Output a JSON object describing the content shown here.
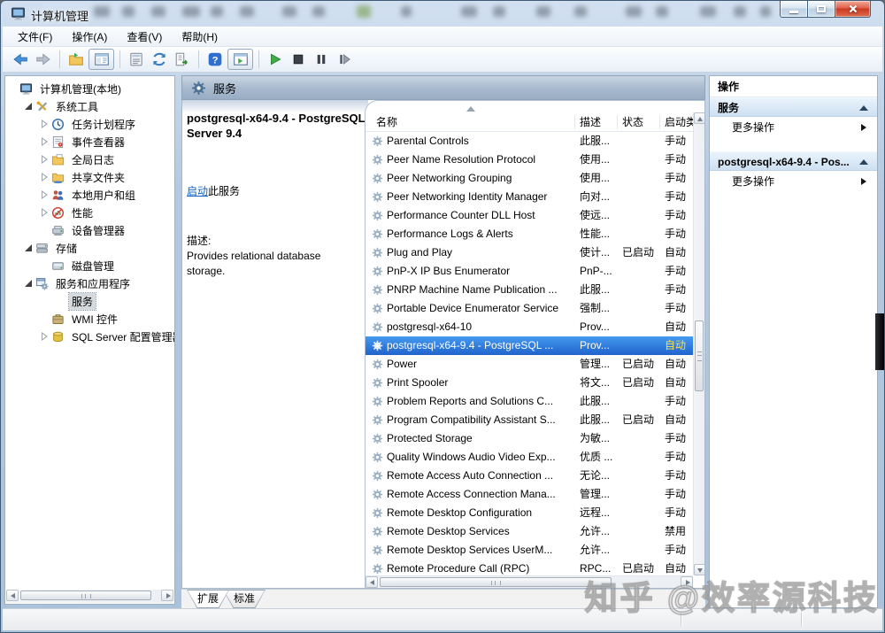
{
  "window": {
    "title": "计算机管理"
  },
  "menu": {
    "items": [
      "文件(F)",
      "操作(A)",
      "查看(V)",
      "帮助(H)"
    ]
  },
  "toolbar": {
    "buttons": [
      {
        "icon": "back"
      },
      {
        "icon": "forward"
      },
      {
        "sep": true
      },
      {
        "icon": "export-folder"
      },
      {
        "icon": "console-window",
        "framed": true
      },
      {
        "sep": true
      },
      {
        "icon": "properties"
      },
      {
        "icon": "refresh"
      },
      {
        "icon": "export-list"
      },
      {
        "sep": true
      },
      {
        "icon": "help"
      },
      {
        "icon": "console-play",
        "framed": true
      },
      {
        "sep": true
      },
      {
        "icon": "start-service"
      },
      {
        "icon": "stop-service"
      },
      {
        "icon": "pause-service"
      },
      {
        "icon": "restart-service"
      }
    ]
  },
  "tree": {
    "items": [
      {
        "label": "计算机管理(本地)",
        "icon": "computer",
        "depth": 0,
        "arrow": null,
        "selected": false
      },
      {
        "label": "系统工具",
        "icon": "tools",
        "depth": 1,
        "arrow": "expanded",
        "selected": false
      },
      {
        "label": "任务计划程序",
        "icon": "scheduler",
        "depth": 2,
        "arrow": "collapsed",
        "selected": false
      },
      {
        "label": "事件查看器",
        "icon": "event-viewer",
        "depth": 2,
        "arrow": "collapsed",
        "selected": false
      },
      {
        "label": "全局日志",
        "icon": "logs",
        "depth": 2,
        "arrow": "collapsed",
        "selected": false
      },
      {
        "label": "共享文件夹",
        "icon": "shared-folders",
        "depth": 2,
        "arrow": "collapsed",
        "selected": false
      },
      {
        "label": "本地用户和组",
        "icon": "local-users",
        "depth": 2,
        "arrow": "collapsed",
        "selected": false
      },
      {
        "label": "性能",
        "icon": "performance",
        "depth": 2,
        "arrow": "collapsed",
        "selected": false
      },
      {
        "label": "设备管理器",
        "icon": "device-manager",
        "depth": 2,
        "arrow": null,
        "selected": false
      },
      {
        "label": "存储",
        "icon": "storage",
        "depth": 1,
        "arrow": "expanded",
        "selected": false
      },
      {
        "label": "磁盘管理",
        "icon": "disk-management",
        "depth": 2,
        "arrow": null,
        "selected": false
      },
      {
        "label": "服务和应用程序",
        "icon": "services-apps",
        "depth": 1,
        "arrow": "expanded",
        "selected": false
      },
      {
        "label": "服务",
        "icon": "services",
        "depth": 2,
        "arrow": null,
        "selected": true
      },
      {
        "label": "WMI 控件",
        "icon": "wmi",
        "depth": 2,
        "arrow": null,
        "selected": false
      },
      {
        "label": "SQL Server 配置管理器",
        "icon": "sql-config",
        "depth": 2,
        "arrow": "collapsed",
        "selected": false
      }
    ]
  },
  "services_panel": {
    "header": "服务",
    "info": {
      "title": "postgresql-x64-9.4 - PostgreSQL Server 9.4",
      "start_link": "启动",
      "start_suffix": "此服务",
      "description_label": "描述:",
      "description": "Provides relational database storage."
    },
    "list": {
      "columns": [
        "名称",
        "描述",
        "状态",
        "启动类型"
      ],
      "rows": [
        {
          "name": "Parental Controls",
          "desc": "此服...",
          "status": "",
          "startup": "手动",
          "selected": false
        },
        {
          "name": "Peer Name Resolution Protocol",
          "desc": "使用...",
          "status": "",
          "startup": "手动",
          "selected": false
        },
        {
          "name": "Peer Networking Grouping",
          "desc": "使用...",
          "status": "",
          "startup": "手动",
          "selected": false
        },
        {
          "name": "Peer Networking Identity Manager",
          "desc": "向对...",
          "status": "",
          "startup": "手动",
          "selected": false
        },
        {
          "name": "Performance Counter DLL Host",
          "desc": "使远...",
          "status": "",
          "startup": "手动",
          "selected": false
        },
        {
          "name": "Performance Logs & Alerts",
          "desc": "性能...",
          "status": "",
          "startup": "手动",
          "selected": false
        },
        {
          "name": "Plug and Play",
          "desc": "使计...",
          "status": "已启动",
          "startup": "自动",
          "selected": false
        },
        {
          "name": "PnP-X IP Bus Enumerator",
          "desc": "PnP-...",
          "status": "",
          "startup": "手动",
          "selected": false
        },
        {
          "name": "PNRP Machine Name Publication ...",
          "desc": "此服...",
          "status": "",
          "startup": "手动",
          "selected": false
        },
        {
          "name": "Portable Device Enumerator Service",
          "desc": "强制...",
          "status": "",
          "startup": "手动",
          "selected": false
        },
        {
          "name": "postgresql-x64-10",
          "desc": "Prov...",
          "status": "",
          "startup": "自动",
          "selected": false
        },
        {
          "name": "postgresql-x64-9.4 - PostgreSQL ...",
          "desc": "Prov...",
          "status": "",
          "startup": "自动",
          "selected": true
        },
        {
          "name": "Power",
          "desc": "管理...",
          "status": "已启动",
          "startup": "自动",
          "selected": false
        },
        {
          "name": "Print Spooler",
          "desc": "将文...",
          "status": "已启动",
          "startup": "自动",
          "selected": false
        },
        {
          "name": "Problem Reports and Solutions C...",
          "desc": "此服...",
          "status": "",
          "startup": "手动",
          "selected": false
        },
        {
          "name": "Program Compatibility Assistant S...",
          "desc": "此服...",
          "status": "已启动",
          "startup": "自动",
          "selected": false
        },
        {
          "name": "Protected Storage",
          "desc": "为敏...",
          "status": "",
          "startup": "手动",
          "selected": false
        },
        {
          "name": "Quality Windows Audio Video Exp...",
          "desc": "优质 ...",
          "status": "",
          "startup": "手动",
          "selected": false
        },
        {
          "name": "Remote Access Auto Connection ...",
          "desc": "无论...",
          "status": "",
          "startup": "手动",
          "selected": false
        },
        {
          "name": "Remote Access Connection Mana...",
          "desc": "管理...",
          "status": "",
          "startup": "手动",
          "selected": false
        },
        {
          "name": "Remote Desktop Configuration",
          "desc": "远程...",
          "status": "",
          "startup": "手动",
          "selected": false
        },
        {
          "name": "Remote Desktop Services",
          "desc": "允许...",
          "status": "",
          "startup": "禁用",
          "selected": false
        },
        {
          "name": "Remote Desktop Services UserM...",
          "desc": "允许...",
          "status": "",
          "startup": "手动",
          "selected": false
        },
        {
          "name": "Remote Procedure Call (RPC)",
          "desc": "RPC...",
          "status": "已启动",
          "startup": "自动",
          "selected": false
        }
      ]
    }
  },
  "actions_panel": {
    "header": "操作",
    "sections": [
      {
        "title": "服务",
        "items": [
          "更多操作"
        ]
      },
      {
        "title": "postgresql-x64-9.4 - Pos...",
        "items": [
          "更多操作"
        ]
      }
    ]
  },
  "tabs": {
    "items": [
      "扩展",
      "标准"
    ],
    "active": "扩展"
  },
  "watermark": "知乎 @效率源科技",
  "colors": {
    "selection": "#2f74d8",
    "selection_text": "#ffffff",
    "startup_selected_text": "#ffe24a",
    "link": "#0b61c4",
    "titlebar": "#b4c9e0",
    "pane_header": "#a6b8cc",
    "action_section": "#cde0f1"
  }
}
